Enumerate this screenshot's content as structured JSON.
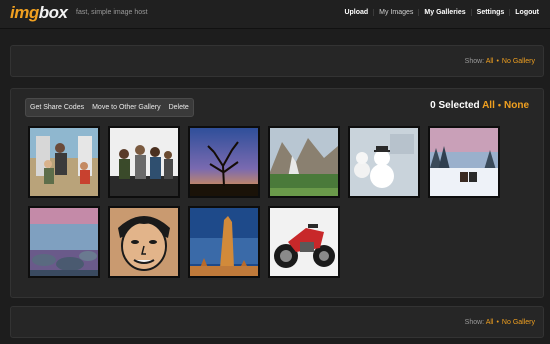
{
  "header": {
    "logo_img": "img",
    "logo_box": "box",
    "tagline": "fast, simple image host",
    "nav": [
      "Upload",
      "My Images",
      "My Galleries",
      "Settings",
      "Logout"
    ]
  },
  "show_filter": {
    "label": "Show:",
    "options": [
      "All",
      "No Gallery"
    ]
  },
  "toolbar": {
    "buttons": [
      "Get Share Codes",
      "Move to Other Gallery",
      "Delete"
    ]
  },
  "selection": {
    "count_text": "0 Selected",
    "options": [
      "All",
      "None"
    ]
  },
  "thumbnails": [
    {
      "name": "thumb-people-outdoors-photo"
    },
    {
      "name": "thumb-group-photo"
    },
    {
      "name": "thumb-tree-sunset-photo"
    },
    {
      "name": "thumb-mountain-valley-photo"
    },
    {
      "name": "thumb-snowman-calendar-photo"
    },
    {
      "name": "thumb-winter-sled-photo"
    },
    {
      "name": "thumb-rocky-shore-photo"
    },
    {
      "name": "thumb-face-illustration"
    },
    {
      "name": "thumb-desert-rock-photo"
    },
    {
      "name": "thumb-motorcycle-photo"
    }
  ],
  "colors": {
    "accent": "#f0a020",
    "background": "#1d1d1d",
    "panel": "#262626"
  }
}
